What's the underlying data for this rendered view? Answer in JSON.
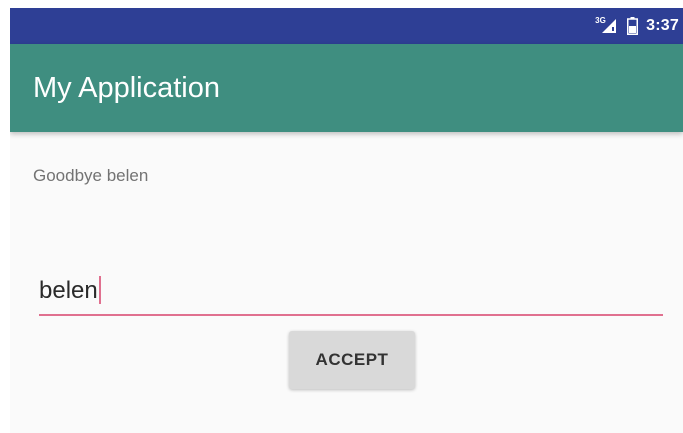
{
  "status_bar": {
    "network_label": "3G",
    "time": "3:37",
    "icons": [
      "signal-icon",
      "battery-icon"
    ]
  },
  "app_bar": {
    "title": "My Application"
  },
  "main": {
    "greeting_text": "Goodbye belen",
    "name_input": {
      "value": "belen"
    },
    "accept_button_label": "ACCEPT"
  },
  "colors": {
    "status_bar": "#2e3f95",
    "app_bar": "#3f8e80",
    "accent": "#e0708f",
    "background": "#fafafa",
    "button": "#d9d9d9"
  }
}
